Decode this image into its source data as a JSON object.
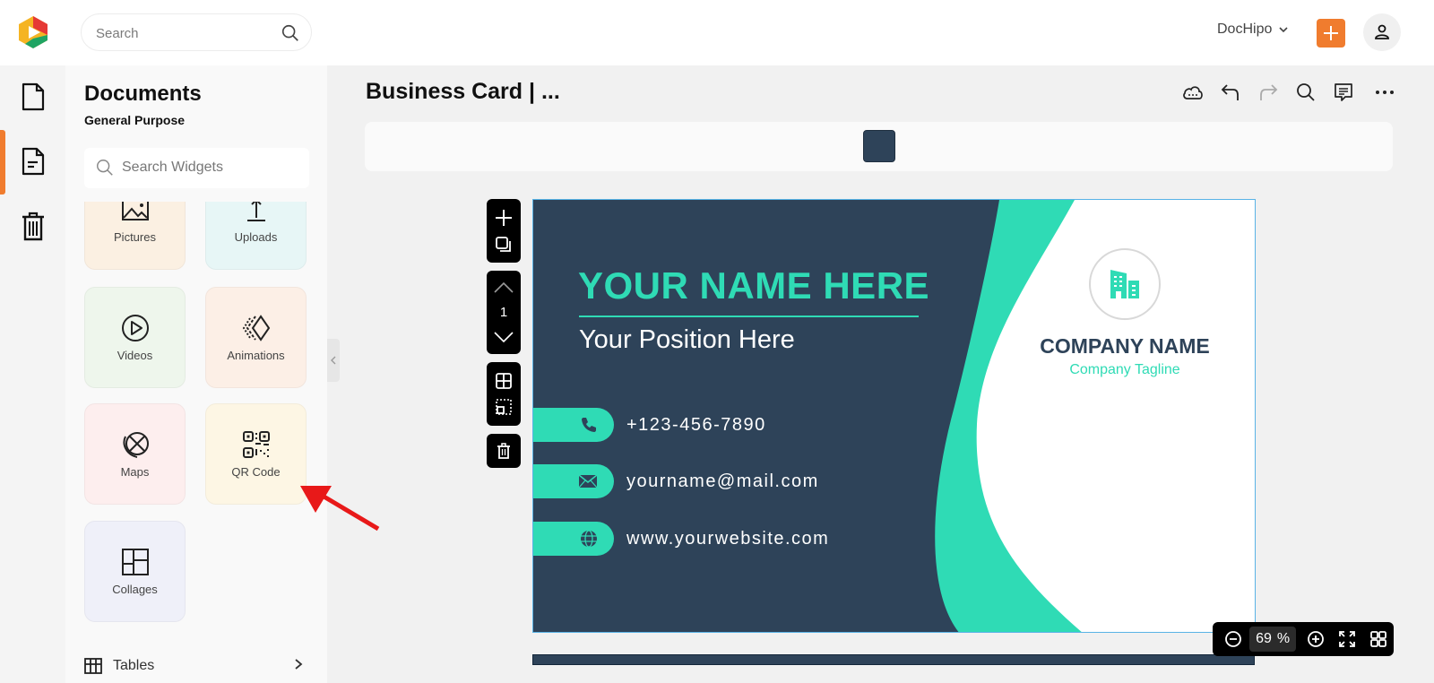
{
  "topbar": {
    "search_placeholder": "Search",
    "account_label": "DocHipo",
    "accent_color": "#f07c2e"
  },
  "rail": {
    "items": [
      {
        "icon": "document-icon",
        "active": false
      },
      {
        "icon": "document-lines-icon",
        "active": true
      },
      {
        "icon": "trash-icon",
        "active": false
      }
    ]
  },
  "panel": {
    "title": "Documents",
    "subtitle": "General Purpose",
    "search_placeholder": "Search Widgets",
    "widgets": [
      {
        "label": "Pictures",
        "icon": "pictures-icon",
        "color": "#fbf0e2"
      },
      {
        "label": "Uploads",
        "icon": "upload-icon",
        "color": "#e7f6f6"
      },
      {
        "label": "Videos",
        "icon": "video-play-icon",
        "color": "#eef6ec"
      },
      {
        "label": "Animations",
        "icon": "animation-icon",
        "color": "#fcefe6"
      },
      {
        "label": "Maps",
        "icon": "globe-icon",
        "color": "#fdeeee"
      },
      {
        "label": "QR Code",
        "icon": "qr-code-icon",
        "color": "#fdf6e4"
      },
      {
        "label": "Collages",
        "icon": "collage-icon",
        "color": "#eff0f9"
      }
    ],
    "tables_label": "Tables"
  },
  "editor": {
    "doc_title": "Business Card | ...",
    "tools": [
      "cloud-save-icon",
      "undo-icon",
      "redo-icon",
      "search-icon",
      "comment-icon",
      "more-icon"
    ],
    "swatch_color": "#2e4359",
    "page_number": "1"
  },
  "card": {
    "name": "YOUR NAME HERE",
    "position": "Your Position Here",
    "phone": "+123-456-7890",
    "email": "yourname@mail.com",
    "website": "www.yourwebsite.com",
    "company": "COMPANY NAME",
    "tagline": "Company Tagline",
    "colors": {
      "navy": "#2e4359",
      "teal": "#2fdbb5",
      "white": "#ffffff"
    }
  },
  "zoom": {
    "value": "69",
    "unit": "%"
  }
}
